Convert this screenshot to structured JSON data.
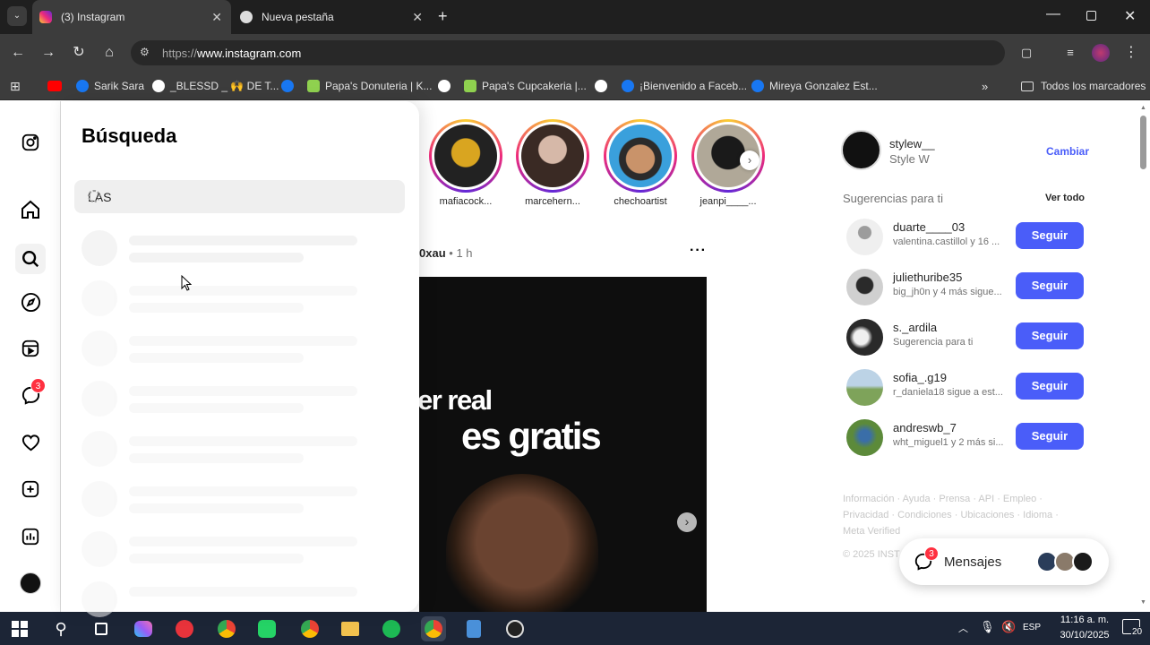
{
  "browser": {
    "tabs": [
      {
        "title": "(3) Instagram",
        "active": true
      },
      {
        "title": "Nueva pestaña",
        "active": false
      }
    ],
    "url_prefix": "https://",
    "url_domain": "www.instagram.com",
    "bookmarks": [
      {
        "label": "Sarik Sara",
        "icon": "facebook-icon"
      },
      {
        "label": "_BLESSD _ 🙌 DE T...",
        "icon": "globe-icon"
      },
      {
        "label": "Papa's Donuteria | K...",
        "icon": "game-icon"
      },
      {
        "label": "Papa's Cupcakeria |...",
        "icon": "game-icon"
      },
      {
        "label": "¡Bienvenido a Faceb...",
        "icon": "facebook-icon"
      },
      {
        "label": "Mireya Gonzalez Est...",
        "icon": "facebook-icon"
      }
    ],
    "all_bookmarks_label": "Todos los marcadores"
  },
  "search_panel": {
    "title": "Búsqueda",
    "query": "LAS"
  },
  "nav": {
    "messages_badge": "3"
  },
  "stories": [
    {
      "name": "mafiacock..."
    },
    {
      "name": "marcehern..."
    },
    {
      "name": "chechoartist"
    },
    {
      "name": "jeanpi____..."
    }
  ],
  "post": {
    "author_fragment": "0xau",
    "time": "1 h",
    "image_text_line1": "er real",
    "image_text_line2": "es gratis"
  },
  "sidebar": {
    "username": "stylew__",
    "fullname": "Style W",
    "switch_label": "Cambiar",
    "suggestions_title": "Sugerencias para ti",
    "see_all": "Ver todo",
    "suggestions": [
      {
        "user": "duarte____03",
        "sub": "valentina.castillol y 16 ...",
        "btn": "Seguir"
      },
      {
        "user": "juliethuribe35",
        "sub": "big_jh0n y 4 más sigue...",
        "btn": "Seguir"
      },
      {
        "user": "s._ardila",
        "sub": "Sugerencia para ti",
        "btn": "Seguir"
      },
      {
        "user": "sofia_.g19",
        "sub": "r_daniela18 sigue a est...",
        "btn": "Seguir"
      },
      {
        "user": "andreswb_7",
        "sub": "wht_miguel1 y 2 más si...",
        "btn": "Seguir"
      }
    ],
    "footer_line1": "Información · Ayuda · Prensa · API · Empleo ·",
    "footer_line2": "Privacidad · Condiciones · Ubicaciones · Idioma ·",
    "footer_line3": "Meta Verified",
    "copyright": "© 2025 INST"
  },
  "messages_pill": {
    "label": "Mensajes",
    "badge": "3"
  },
  "taskbar": {
    "lang": "ESP",
    "time": "11:16 a. m.",
    "date": "30/10/2025",
    "notif_count": "20"
  },
  "colors": {
    "follow_button": "#4a5df9",
    "chrome_dark": "#3c3c3c",
    "taskbar": "#1c2536"
  }
}
